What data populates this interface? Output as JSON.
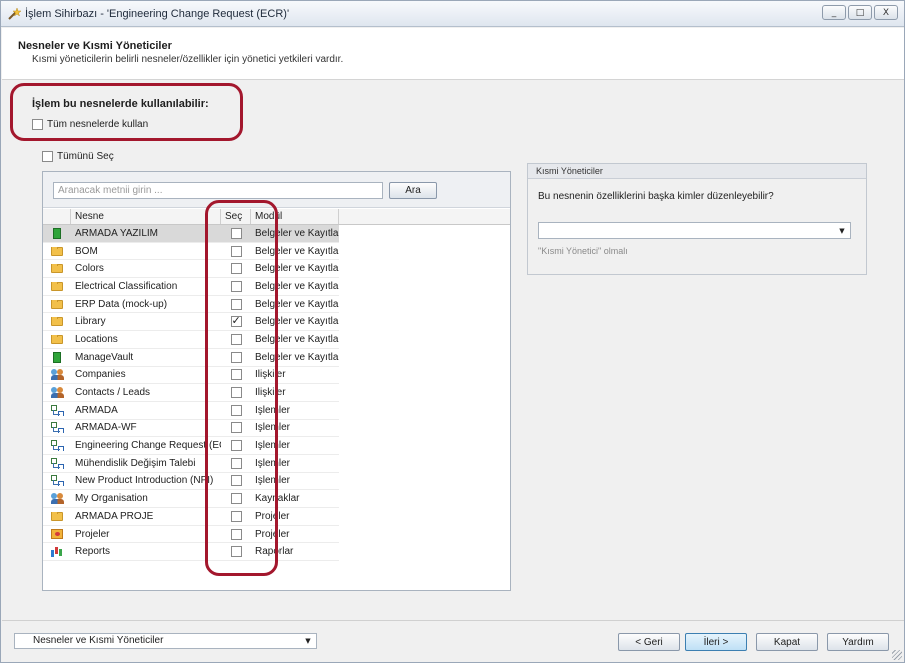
{
  "window": {
    "title": "İşlem Sihirbazı - 'Engineering Change Request (ECR)'",
    "controls": [
      "_",
      "□",
      "X"
    ]
  },
  "header": {
    "title": "Nesneler ve Kısmi Yöneticiler",
    "subtitle": "Kısmi yöneticilerin belirli nesneler/özellikler için yönetici yetkileri vardır."
  },
  "usage": {
    "label": "İşlem bu nesnelerde kullanılabilir:",
    "all_objects_checkbox": "Tüm nesnelerde kullan",
    "all_objects_checked": false
  },
  "select_all": {
    "label": "Tümünü Seç",
    "checked": false
  },
  "search": {
    "placeholder": "Aranacak metnii girin ...",
    "button": "Ara"
  },
  "grid": {
    "columns": {
      "nesne": "Nesne",
      "sec": "Seç",
      "modul": "Modül"
    },
    "rows": [
      {
        "icon": "vault-icon",
        "name": "ARMADA YAZILIM",
        "checked": false,
        "module": "Belgeler ve Kayıtlar",
        "selected": true
      },
      {
        "icon": "folder-icon",
        "name": "BOM",
        "checked": false,
        "module": "Belgeler ve Kayıtlar"
      },
      {
        "icon": "folder-icon",
        "name": "Colors",
        "checked": false,
        "module": "Belgeler ve Kayıtlar"
      },
      {
        "icon": "folder-icon",
        "name": "Electrical Classification",
        "checked": false,
        "module": "Belgeler ve Kayıtlar"
      },
      {
        "icon": "folder-icon",
        "name": "ERP Data (mock-up)",
        "checked": false,
        "module": "Belgeler ve Kayıtlar"
      },
      {
        "icon": "folder-icon",
        "name": "Library",
        "checked": true,
        "module": "Belgeler ve Kayıtlar"
      },
      {
        "icon": "folder-icon",
        "name": "Locations",
        "checked": false,
        "module": "Belgeler ve Kayıtlar"
      },
      {
        "icon": "vault-icon",
        "name": "ManageVault",
        "checked": false,
        "module": "Belgeler ve Kayıtlar"
      },
      {
        "icon": "people-icon",
        "name": "Companies",
        "checked": false,
        "module": "İlişkiler"
      },
      {
        "icon": "people-icon",
        "name": "Contacts / Leads",
        "checked": false,
        "module": "İlişkiler"
      },
      {
        "icon": "workflow-icon",
        "name": "ARMADA",
        "checked": false,
        "module": "İşlemler"
      },
      {
        "icon": "workflow-icon",
        "name": "ARMADA-WF",
        "checked": false,
        "module": "İşlemler"
      },
      {
        "icon": "workflow-icon",
        "name": "Engineering Change Request (ECR)",
        "checked": false,
        "module": "İşlemler"
      },
      {
        "icon": "workflow-icon",
        "name": "Mühendislik Değişim Talebi",
        "checked": false,
        "module": "İşlemler"
      },
      {
        "icon": "workflow-icon",
        "name": "New Product Introduction (NPI)",
        "checked": false,
        "module": "İşlemler"
      },
      {
        "icon": "people-icon",
        "name": "My Organisation",
        "checked": false,
        "module": "Kaynaklar"
      },
      {
        "icon": "folder-icon",
        "name": "ARMADA PROJE",
        "checked": false,
        "module": "Projeler"
      },
      {
        "icon": "project-icon",
        "name": "Projeler",
        "checked": false,
        "module": "Projeler"
      },
      {
        "icon": "report-icon",
        "name": "Reports",
        "checked": false,
        "module": "Raporlar"
      }
    ]
  },
  "partial_admins": {
    "title": "Kısmi Yöneticiler",
    "question": "Bu nesnenin özelliklerini başka kimler düzenleyebilir?",
    "selected_value": "",
    "hint": "\"Kısmi Yönetici\" olmalı"
  },
  "footer": {
    "step_select": "Nesneler ve Kısmi Yöneticiler",
    "back": "< Geri",
    "next": "İleri >",
    "close": "Kapat",
    "help": "Yardım"
  },
  "colors": {
    "highlight": "#a3172d",
    "selected_row": "#d9d9d9",
    "primary_button": "#bfe0f6"
  }
}
